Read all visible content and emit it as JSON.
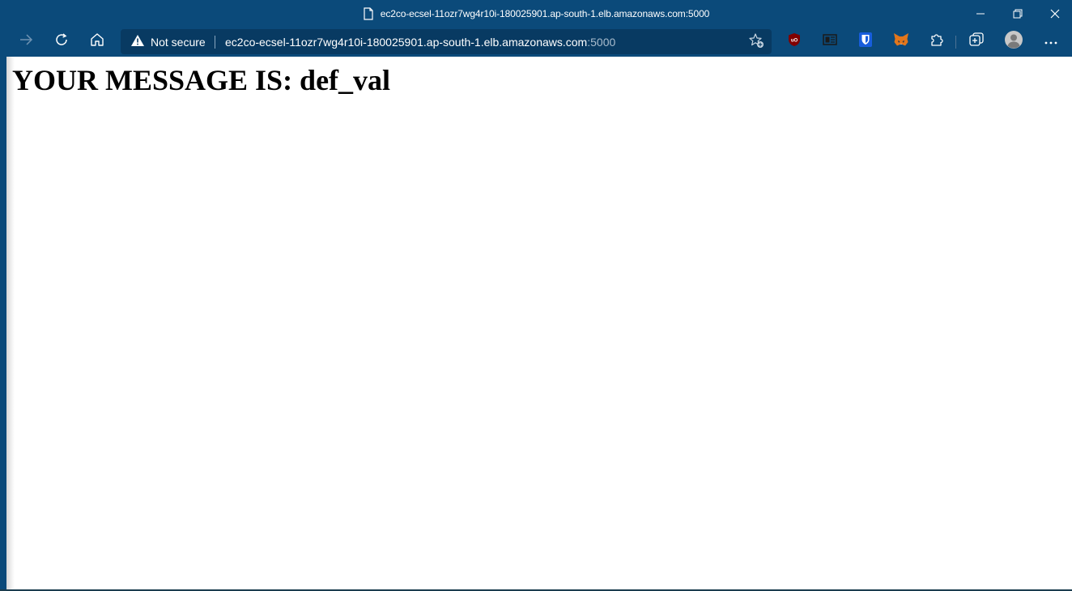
{
  "window": {
    "title": "ec2co-ecsel-11ozr7wg4r10i-180025901.ap-south-1.elb.amazonaws.com:5000"
  },
  "toolbar": {
    "security_label": "Not secure",
    "url_host": "ec2co-ecsel-11ozr7wg4r10i-180025901.ap-south-1.elb.amazonaws.com",
    "url_port": ":5000",
    "extensions": [
      "ublock-origin-icon",
      "reader-icon",
      "bitwarden-icon",
      "metamask-icon",
      "puzzle-icon",
      "collections-icon"
    ]
  },
  "page": {
    "message": "YOUR MESSAGE IS: def_val"
  },
  "colors": {
    "chrome_bg": "#0b4a7a",
    "omnibox_bg": "#083a62",
    "page_bg": "#ffffff"
  }
}
